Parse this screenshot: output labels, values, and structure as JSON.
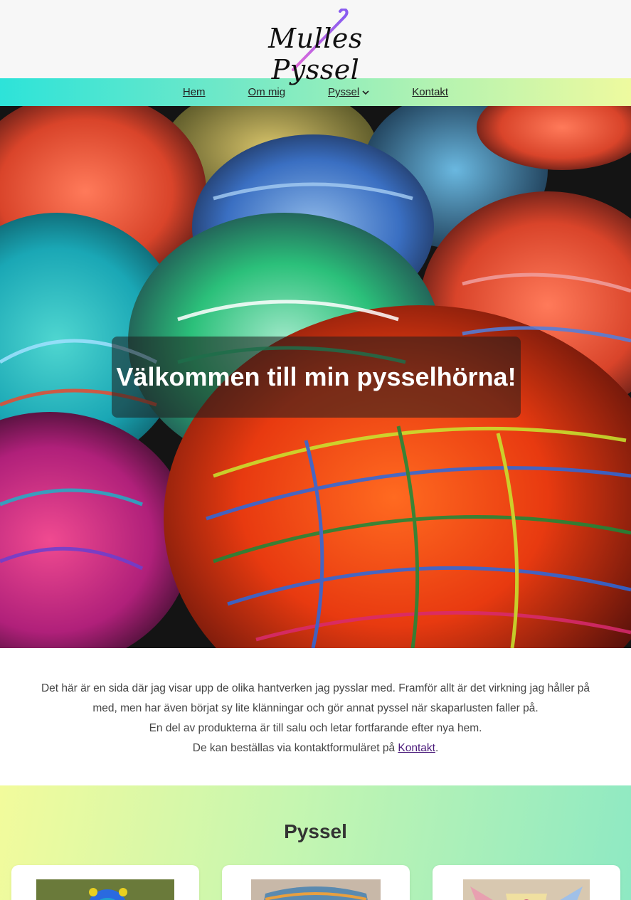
{
  "header": {
    "logo_text": "Mulles Pyssel"
  },
  "nav": {
    "items": [
      {
        "label": "Hem"
      },
      {
        "label": "Om mig"
      },
      {
        "label": "Pyssel",
        "has_dropdown": true
      },
      {
        "label": "Kontakt"
      }
    ]
  },
  "hero": {
    "title": "Välkommen till min pysselhörna!"
  },
  "intro": {
    "line1": "Det här är en sida där jag visar upp de olika hantverken jag pysslar med. Framför allt är det virkning jag håller på med, men har även börjat sy lite klänningar och gör annat pyssel när skaparlusten faller på.",
    "line2": "En del av produkterna är till salu och letar fortfarande efter nya hem.",
    "line3_prefix": "De kan beställas via kontaktformuläret på ",
    "line3_link": "Kontakt",
    "line3_suffix": "."
  },
  "pyssel": {
    "title": "Pyssel"
  },
  "colors": {
    "nav_gradient_start": "#2de3d9",
    "nav_gradient_end": "#eefa9f",
    "section_gradient_start": "#f2fb9c",
    "section_gradient_end": "#8ee9c3",
    "link": "#4a1a7a",
    "hook_pink": "#e36bd8",
    "hook_purple": "#8a5cf0"
  }
}
